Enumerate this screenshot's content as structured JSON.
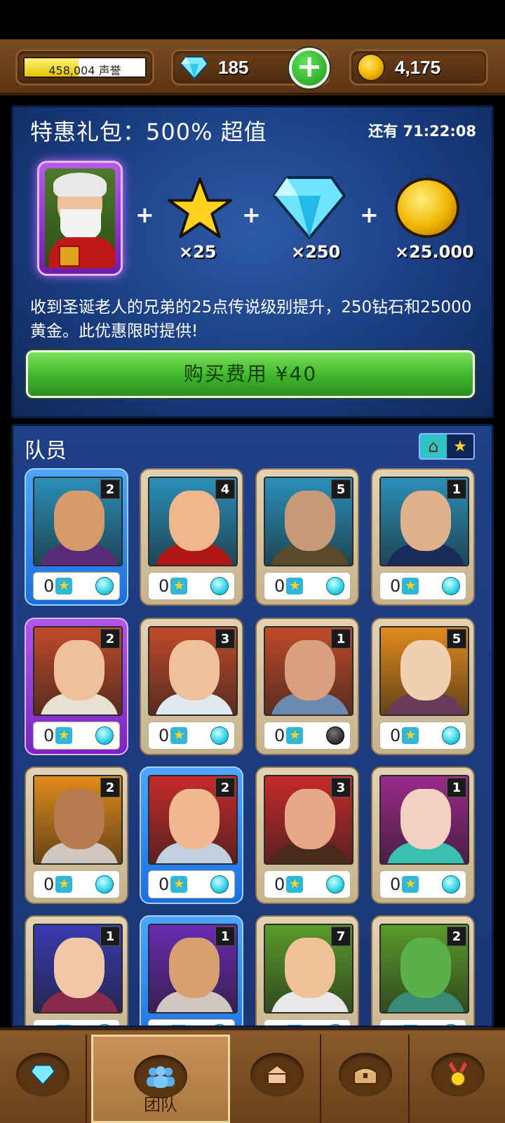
{
  "topbar": {
    "reputation_text": "458,004 声誉",
    "reputation_fill": 0.45,
    "gems": "185",
    "gold": "4,175"
  },
  "offer": {
    "title": "特惠礼包：500% 超值",
    "timer": "还有 71:22:08",
    "rewards": {
      "stars": "×25",
      "gems": "×250",
      "gold": "×25.000"
    },
    "description": "收到圣诞老人的兄弟的25点传说级别提升，250钻石和25000黄金。此优惠限时提供!",
    "buy_label": "购买费用 ¥40"
  },
  "team": {
    "title": "队员",
    "cards": [
      {
        "level": "2",
        "stars": "0",
        "frame": "blue",
        "bg": "#2a8fb8",
        "skin": "#d89a6a",
        "cloth": "#5a2a7a",
        "orb": "cyan"
      },
      {
        "level": "4",
        "stars": "0",
        "frame": "tan",
        "bg": "#2a8fb8",
        "skin": "#f0b88a",
        "cloth": "#b01818",
        "orb": "cyan"
      },
      {
        "level": "5",
        "stars": "0",
        "frame": "tan",
        "bg": "#2a8fb8",
        "skin": "#c99a7a",
        "cloth": "#5a4a2a",
        "orb": "cyan"
      },
      {
        "level": "1",
        "stars": "0",
        "frame": "tan",
        "bg": "#2a8fb8",
        "skin": "#e0b08a",
        "cloth": "#1a2a5a",
        "orb": "cyan"
      },
      {
        "level": "2",
        "stars": "0",
        "frame": "purple",
        "bg": "#c04a2a",
        "skin": "#f0c09a",
        "cloth": "#e8e0d0",
        "orb": "cyan"
      },
      {
        "level": "3",
        "stars": "0",
        "frame": "tan",
        "bg": "#c04a2a",
        "skin": "#f0c09a",
        "cloth": "#e0e8f0",
        "orb": "cyan"
      },
      {
        "level": "1",
        "stars": "0",
        "frame": "tan",
        "bg": "#c04a2a",
        "skin": "#d8a080",
        "cloth": "#6a8ab0",
        "orb": "dark"
      },
      {
        "level": "5",
        "stars": "0",
        "frame": "tan",
        "bg": "#e08a1a",
        "skin": "#f0d0b0",
        "cloth": "#6a3a5a",
        "orb": "cyan"
      },
      {
        "level": "2",
        "stars": "0",
        "frame": "tan",
        "bg": "#e08a1a",
        "skin": "#b87a50",
        "cloth": "#d0c8c0",
        "orb": "cyan"
      },
      {
        "level": "2",
        "stars": "0",
        "frame": "blue",
        "bg": "#c42a2a",
        "skin": "#f0b890",
        "cloth": "#c0d0e0",
        "orb": "cyan"
      },
      {
        "level": "3",
        "stars": "0",
        "frame": "tan",
        "bg": "#c42a2a",
        "skin": "#e8a888",
        "cloth": "#4a2a1a",
        "orb": "cyan"
      },
      {
        "level": "1",
        "stars": "0",
        "frame": "tan",
        "bg": "#9a2a8a",
        "skin": "#f4d0c0",
        "cloth": "#3ac0b0",
        "orb": "cyan"
      },
      {
        "level": "1",
        "stars": "0",
        "frame": "tan",
        "bg": "#3a3ab0",
        "skin": "#f0c8a8",
        "cloth": "#8a2a4a",
        "orb": "cyan"
      },
      {
        "level": "1",
        "stars": "0",
        "frame": "blue",
        "bg": "#6a2ab0",
        "skin": "#d8a070",
        "cloth": "#d0c8c0",
        "orb": "cyan"
      },
      {
        "level": "7",
        "stars": "0",
        "frame": "tan",
        "bg": "#5a9a2a",
        "skin": "#f0c098",
        "cloth": "#e8e8e8",
        "orb": "cyan"
      },
      {
        "level": "2",
        "stars": "0",
        "frame": "tan",
        "bg": "#5a9a2a",
        "skin": "#5ab04a",
        "cloth": "#3a8a7a",
        "orb": "cyan"
      }
    ]
  },
  "nav": {
    "tabs": [
      {
        "name": "gems-tab",
        "icon": "gem-icon",
        "label": ""
      },
      {
        "name": "team-tab",
        "icon": "team-icon",
        "label": "团队",
        "active": true
      },
      {
        "name": "buildings-tab",
        "icon": "buildings-icon",
        "label": ""
      },
      {
        "name": "treasure-tab",
        "icon": "chest-icon",
        "label": ""
      },
      {
        "name": "achievements-tab",
        "icon": "medal-icon",
        "label": ""
      }
    ]
  },
  "colors": {
    "panel_blue": "#1f3f87",
    "wood": "#7a4b22",
    "buy_green": "#3fb52b",
    "gem_cyan": "#2fd1e6"
  }
}
